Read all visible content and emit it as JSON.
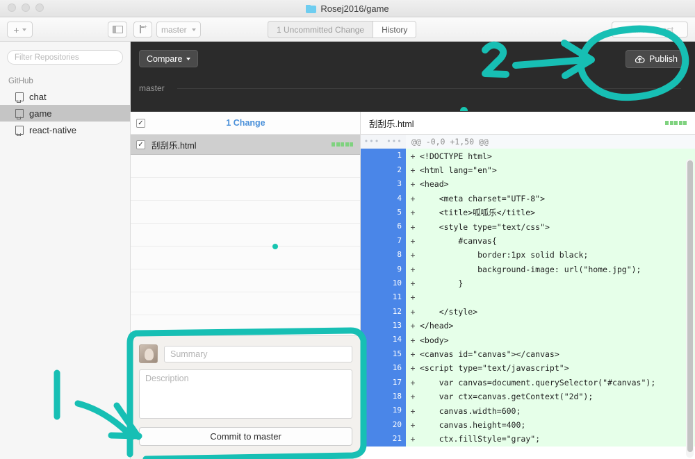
{
  "window": {
    "title": "Rosej2016/game",
    "folder_icon": "folder-icon"
  },
  "toolbar": {
    "add_label": "+",
    "add_caret": "▾",
    "sidebar_toggle_icon": "sidebar-toggle-icon",
    "new_branch_icon": "new-branch-icon",
    "branch_name": "master",
    "branch_caret": "▾",
    "tabs": [
      {
        "label": "1 Uncommitted Change",
        "active": false
      },
      {
        "label": "History",
        "active": true
      }
    ],
    "right_button_label": "Pull Request"
  },
  "sidebar": {
    "filter_placeholder": "Filter Repositories",
    "group_label": "GitHub",
    "repos": [
      {
        "name": "chat",
        "selected": false
      },
      {
        "name": "game",
        "selected": true
      },
      {
        "name": "react-native",
        "selected": false
      }
    ]
  },
  "compare_bar": {
    "compare_label": "Compare",
    "caret": "▾",
    "branch_label": "master",
    "publish_label": "Publish",
    "publish_icon": "cloud-upload-icon"
  },
  "changes": {
    "header_label": "1 Change",
    "header_checkbox_checked": true,
    "check_glyph": "✓",
    "files": [
      {
        "name": "刮刮乐.html",
        "checked": true,
        "diffstat_added": 5,
        "diffstat_total": 5
      }
    ]
  },
  "commit_form": {
    "avatar": "user-avatar",
    "summary_placeholder": "Summary",
    "description_placeholder": "Description",
    "commit_button_label": "Commit to master"
  },
  "diff": {
    "file_name": "刮刮乐.html",
    "diffstat_added": 5,
    "diffstat_total": 5,
    "hunk_header": "@@ -0,0 +1,50 @@",
    "gutter_placeholder": "•••",
    "lines": [
      {
        "num": 1,
        "sign": "+",
        "text": "<!DOCTYPE html>"
      },
      {
        "num": 2,
        "sign": "+",
        "text": "<html lang=\"en\">"
      },
      {
        "num": 3,
        "sign": "+",
        "text": "<head>"
      },
      {
        "num": 4,
        "sign": "+",
        "text": "    <meta charset=\"UTF-8\">"
      },
      {
        "num": 5,
        "sign": "+",
        "text": "    <title>呱呱乐</title>"
      },
      {
        "num": 6,
        "sign": "+",
        "text": "    <style type=\"text/css\">"
      },
      {
        "num": 7,
        "sign": "+",
        "text": "        #canvas{"
      },
      {
        "num": 8,
        "sign": "+",
        "text": "            border:1px solid black;"
      },
      {
        "num": 9,
        "sign": "+",
        "text": "            background-image: url(\"home.jpg\");"
      },
      {
        "num": 10,
        "sign": "+",
        "text": "        }"
      },
      {
        "num": 11,
        "sign": "+",
        "text": ""
      },
      {
        "num": 12,
        "sign": "+",
        "text": "    </style>"
      },
      {
        "num": 13,
        "sign": "+",
        "text": "</head>"
      },
      {
        "num": 14,
        "sign": "+",
        "text": "<body>"
      },
      {
        "num": 15,
        "sign": "+",
        "text": "<canvas id=\"canvas\"></canvas>"
      },
      {
        "num": 16,
        "sign": "+",
        "text": "<script type=\"text/javascript\">"
      },
      {
        "num": 17,
        "sign": "+",
        "text": "    var canvas=document.querySelector(\"#canvas\");"
      },
      {
        "num": 18,
        "sign": "+",
        "text": "    var ctx=canvas.getContext(\"2d\");"
      },
      {
        "num": 19,
        "sign": "+",
        "text": "    canvas.width=600;"
      },
      {
        "num": 20,
        "sign": "+",
        "text": "    canvas.height=400;"
      },
      {
        "num": 21,
        "sign": "+",
        "text": "    ctx.fillStyle=\"gray\";"
      }
    ]
  },
  "annotations": {
    "color": "#17bfb4",
    "marker_1": "1",
    "marker_2": "2",
    "circle_target": "publish-button",
    "rect_target": "commit-form"
  }
}
